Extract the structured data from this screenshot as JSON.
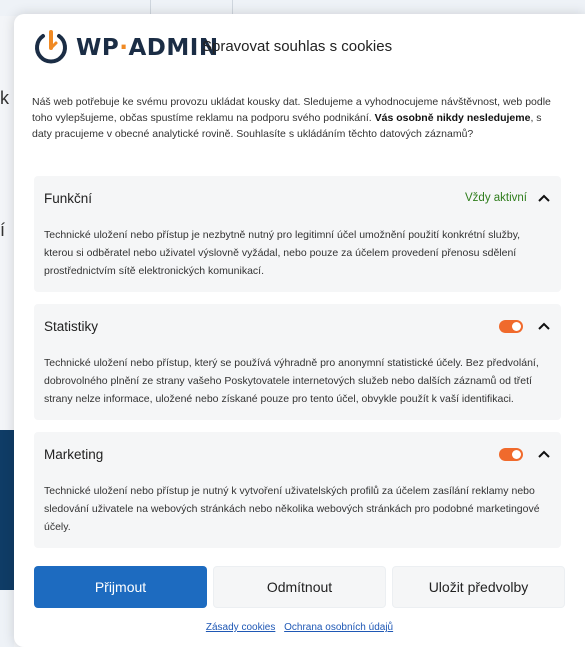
{
  "background": {
    "chars": [
      "k",
      "í"
    ]
  },
  "header": {
    "logo_wp": "WP",
    "logo_dot": "·",
    "logo_admin": "ADMIN",
    "title": "Spravovat souhlas s cookies"
  },
  "intro": {
    "part1": "Náš web potřebuje ke svému provozu ukládat kousky dat. Sledujeme a vyhodnocujeme návštěvnost, web podle toho vylepšujeme, občas spustíme reklamu na podporu svého podnikání. ",
    "bold": "Vás osobně nikdy nesledujeme",
    "part2": ", s daty pracujeme v obecné analytické rovině. Souhlasíte s ukládáním těchto datových záznamů?"
  },
  "categories": [
    {
      "name": "Funkční",
      "status": "Vždy aktivní",
      "description": "Technické uložení nebo přístup je nezbytně nutný pro legitimní účel umožnění použití konkrétní služby, kterou si odběratel nebo uživatel výslovně vyžádal, nebo pouze za účelem provedení přenosu sdělení prostřednictvím sítě elektronických komunikací."
    },
    {
      "name": "Statistiky",
      "toggle_on": true,
      "description": "Technické uložení nebo přístup, který se používá výhradně pro anonymní statistické účely. Bez předvolání, dobrovolného plnění ze strany vašeho Poskytovatele internetových služeb nebo dalších záznamů od třetí strany nelze informace, uložené nebo získané pouze pro tento účel, obvykle použít k vaší identifikaci."
    },
    {
      "name": "Marketing",
      "toggle_on": true,
      "description": "Technické uložení nebo přístup je nutný k vytvoření uživatelských profilů za účelem zasílání reklamy nebo sledování uživatele na webových stránkách nebo několika webových stránkách pro podobné marketingové účely."
    }
  ],
  "buttons": {
    "accept": "Přijmout",
    "deny": "Odmítnout",
    "save": "Uložit předvolby"
  },
  "links": {
    "cookies": "Zásady cookies",
    "privacy": "Ochrana osobních údajů"
  },
  "colors": {
    "primary": "#1d6bc0",
    "toggle": "#f06a2c",
    "active_text": "#2f7d1c",
    "logo_orange": "#f08a24",
    "logo_navy": "#1b2d45"
  }
}
